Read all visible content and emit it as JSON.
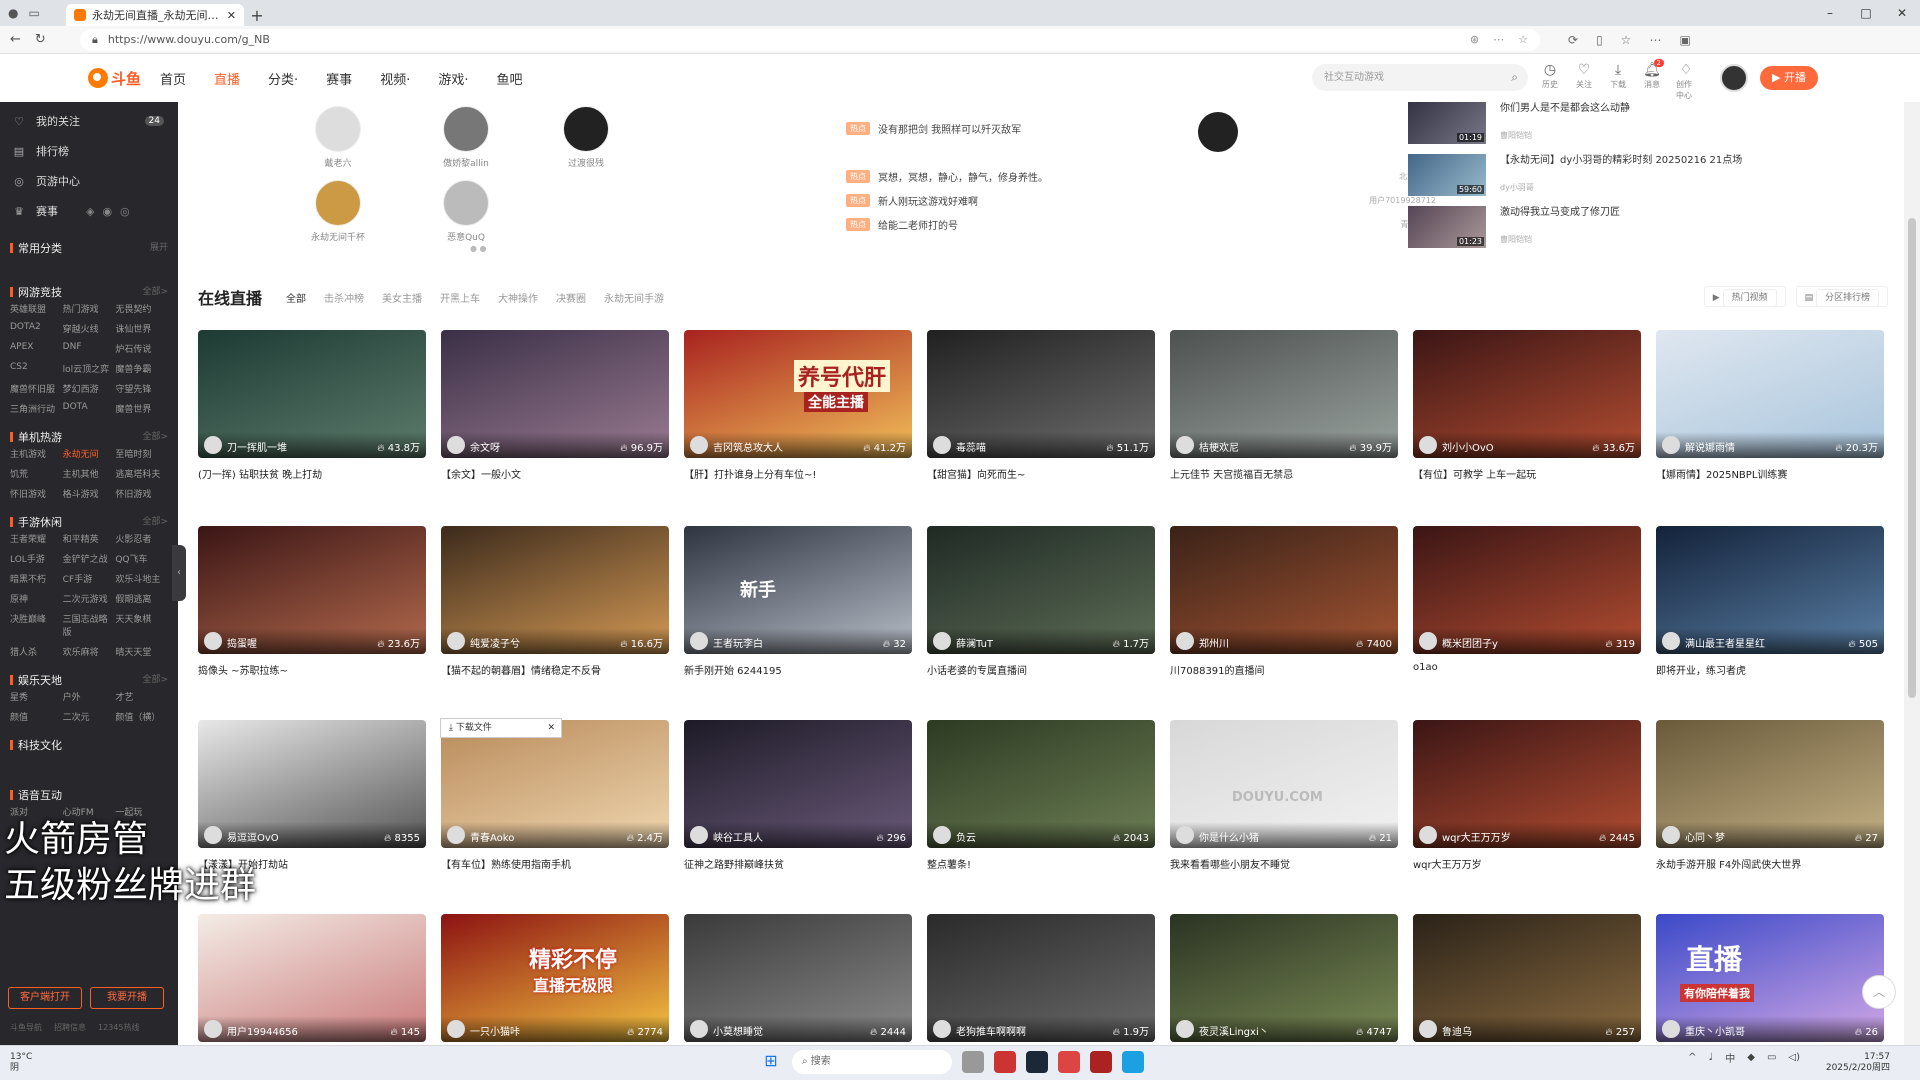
{
  "browser": {
    "tab_title": "永劫无间直播_永劫无间直播解说",
    "url": "https://www.douyu.com/g_NB",
    "window_controls": [
      "–",
      "□",
      "✕"
    ]
  },
  "nav": {
    "logo": "斗鱼",
    "logo_sub": "DOUYU.COM",
    "menu": [
      "首页",
      "直播",
      "分类·",
      "赛事",
      "视频·",
      "游戏·",
      "鱼吧"
    ],
    "active": "直播",
    "search_placeholder": "社交互动游戏",
    "user_icons": [
      {
        "icon": "history-icon",
        "label": "历史"
      },
      {
        "icon": "heart-icon",
        "label": "关注"
      },
      {
        "icon": "download-icon",
        "label": "下载"
      },
      {
        "icon": "bell-icon",
        "label": "消息",
        "badge": "2"
      },
      {
        "icon": "bulb-icon",
        "label": "创作中心"
      }
    ],
    "live_button": "开播"
  },
  "sidebar": {
    "items": [
      {
        "icon": "heart-icon",
        "label": "我的关注",
        "count": "24"
      },
      {
        "icon": "rank-icon",
        "label": "排行榜"
      },
      {
        "icon": "guard-icon",
        "label": "页游中心"
      },
      {
        "icon": "trophy-icon",
        "label": "赛事"
      }
    ],
    "sections": [
      {
        "title": "常用分类",
        "more": "展开",
        "games": []
      },
      {
        "title": "网游竞技",
        "more": "全部>",
        "games": [
          "英雄联盟",
          "热门游戏",
          "无畏契约",
          "DOTA2",
          "穿越火线",
          "诛仙世界",
          "APEX",
          "DNF",
          "炉石传说",
          "CS2",
          "lol云顶之弈",
          "魔兽争霸",
          "魔兽怀旧服",
          "梦幻西游",
          "守望先锋",
          "三角洲行动",
          "DOTA",
          "魔兽世界"
        ]
      },
      {
        "title": "单机热游",
        "more": "全部>",
        "games": [
          "主机游戏",
          "永劫无间",
          "至暗时刻",
          "饥荒",
          "主机其他",
          "逃离塔科夫",
          "怀旧游戏",
          "格斗游戏",
          "怀旧游戏"
        ]
      },
      {
        "title": "手游休闲",
        "more": "全部>",
        "games": [
          "王者荣耀",
          "和平精英",
          "火影忍者",
          "LOL手游",
          "金铲铲之战",
          "QQ飞车",
          "暗黑不朽",
          "CF手游",
          "欢乐斗地主",
          "原神",
          "二次元游戏",
          "假期逃离",
          "决胜巅峰",
          "三国志战略版",
          "天天象棋",
          "猎人杀",
          "欢乐麻将",
          "晴天天堂"
        ]
      },
      {
        "title": "娱乐天地",
        "more": "全部>",
        "games": [
          "星秀",
          "户外",
          "才艺",
          "颜值",
          "二次元",
          "颜值（横）"
        ]
      },
      {
        "title": "科技文化",
        "more": "",
        "games": []
      },
      {
        "title": "语音互动",
        "more": "",
        "games": [
          "派对",
          "心动FM",
          "一起玩"
        ]
      }
    ],
    "btn_client": "客户端打开",
    "btn_live": "我要开播",
    "footer": [
      "斗鱼导航",
      "招聘信息",
      "12345热线"
    ]
  },
  "hot_streamers": [
    {
      "name": "戴老六"
    },
    {
      "name": "傲娇黎allin"
    },
    {
      "name": "过渡很残"
    },
    {
      "name": "永劫无间千杯"
    },
    {
      "name": "恶意QuQ"
    }
  ],
  "news": [
    {
      "tag": "热点",
      "text": "没有那把剑 我照样可以歼灭敌军",
      "src": ""
    },
    {
      "tag": "热点",
      "text": "冥想，冥想，静心，静气，修身养性。",
      "src": "北荒e烟铭"
    },
    {
      "tag": "热点",
      "text": "新人刚玩这游戏好难啊",
      "src": "用户7019928712"
    },
    {
      "tag": "热点",
      "text": "给能二老师打的号",
      "src": "青春Aoko"
    }
  ],
  "videos": [
    {
      "title": "你们男人是不是都会这么动静",
      "author": "曹阳铠铠",
      "duration": "01:19"
    },
    {
      "title": "【永劫无间】dy小羽哥的精彩时刻 20250216 21点场",
      "author": "dy小羽哥",
      "duration": "59:60"
    },
    {
      "title": "激动得我立马变成了修刀匠",
      "author": "曹阳铠铠",
      "duration": "01:23"
    }
  ],
  "section": {
    "title": "在线直播",
    "filters": [
      "全部",
      "击杀冲榜",
      "美女主播",
      "开黑上车",
      "大神操作",
      "决赛圈",
      "永劫无间手游"
    ],
    "btn_hot_video": "热门视频",
    "btn_rank": "分区排行榜"
  },
  "cards": [
    {
      "anchor": "刀一挥肌一堆",
      "heat": "43.8万",
      "title": "(刀一挥) 钻职扶贫 晚上打劫"
    },
    {
      "anchor": "余文呀",
      "heat": "96.9万",
      "title": "【余文】一般小文"
    },
    {
      "anchor": "吉冈筑总攻大人",
      "heat": "41.2万",
      "title": "【肝】打扑谁身上分有车位~!"
    },
    {
      "anchor": "毒蕊喵",
      "heat": "51.1万",
      "title": "【甜宫猫】向死而生~"
    },
    {
      "anchor": "桔梗欢尼",
      "heat": "39.9万",
      "title": "上元佳节 天宫揽福百无禁忌"
    },
    {
      "anchor": "刘小小OvO",
      "heat": "33.6万",
      "title": "【有位】可教学 上车一起玩"
    },
    {
      "anchor": "解说娜雨情",
      "heat": "20.3万",
      "title": "【娜雨情】2025NBPL训练赛"
    },
    {
      "anchor": "捣蛋喔",
      "heat": "23.6万",
      "title": "捣像头 ~苏职拉练~"
    },
    {
      "anchor": "纯爱凌子兮",
      "heat": "16.6万",
      "title": "【猫不起的朝暮眉】情绪稳定不反骨"
    },
    {
      "anchor": "王者玩李白",
      "heat": "32",
      "title": "新手刚开始 6244195"
    },
    {
      "anchor": "薛澜TuT",
      "heat": "1.7万",
      "title": "小话老婆的专属直播间"
    },
    {
      "anchor": "郑州川",
      "heat": "7400",
      "title": "川7088391的直播间"
    },
    {
      "anchor": "概米团团子y",
      "heat": "319",
      "title": "o1ao"
    },
    {
      "anchor": "满山最王者星星红",
      "heat": "505",
      "title": "即将开业，练习者虎"
    },
    {
      "anchor": "易逗逗OvO",
      "heat": "8355",
      "title": "【漾漾】开始打劫站"
    },
    {
      "anchor": "青春Aoko",
      "heat": "2.4万",
      "title": "【有车位】熟练使用指南手机"
    },
    {
      "anchor": "峡谷工具人",
      "heat": "296",
      "title": "征神之路野排巅峰扶贫"
    },
    {
      "anchor": "负云",
      "heat": "2043",
      "title": "整点薯条!"
    },
    {
      "anchor": "你是什么小猪",
      "heat": "21",
      "title": "我来看看哪些小朋友不睡觉"
    },
    {
      "anchor": "wqr大王万万岁",
      "heat": "2445",
      "title": "wqr大王万万岁"
    },
    {
      "anchor": "心同丶梦",
      "heat": "27",
      "title": "永劫手游开服 F4外闯武侠大世界"
    },
    {
      "anchor": "用户19944656",
      "heat": "145",
      "title": ""
    },
    {
      "anchor": "一只小猫咔",
      "heat": "2774",
      "title": ""
    },
    {
      "anchor": "小莫想睡觉",
      "heat": "2444",
      "title": ""
    },
    {
      "anchor": "老狗推车啊啊啊",
      "heat": "1.9万",
      "title": ""
    },
    {
      "anchor": "夜灵溪Lingxi丶",
      "heat": "4747",
      "title": ""
    },
    {
      "anchor": "鲁迪乌",
      "heat": "257",
      "title": ""
    },
    {
      "anchor": "重庆丶小凯哥",
      "heat": "26",
      "title": ""
    }
  ],
  "card_overlays": [
    "养号代肝",
    "全能主播",
    "新手",
    "DOUYU.COM",
    "精彩不停",
    "直播无极限",
    "直播",
    "有你陪伴着我"
  ],
  "download_popup": "下载文件",
  "watermark": [
    "火箭房管",
    "五级粉丝牌进群"
  ],
  "taskbar": {
    "temp": "13°C",
    "weather": "阴",
    "search": "搜索",
    "time": "17:57",
    "date": "2025/2/20周四",
    "ime": "中"
  },
  "colors": {
    "accent": "#ff5d23",
    "sidebar_bg": "#28282c"
  }
}
